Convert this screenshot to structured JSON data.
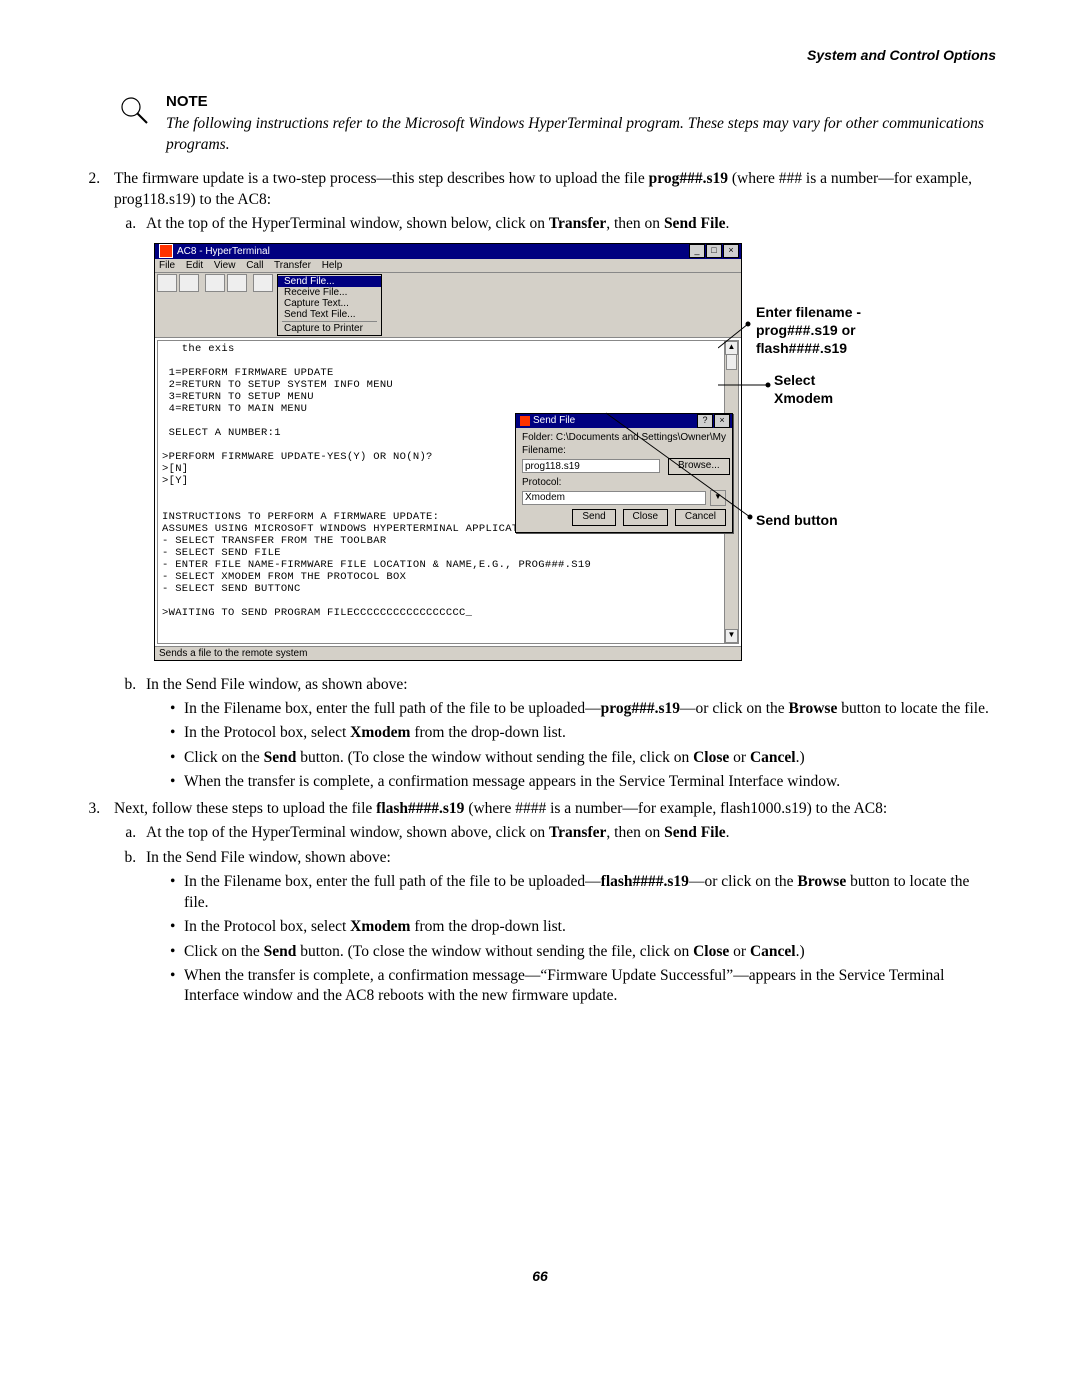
{
  "header": {
    "section": "System and Control Options"
  },
  "note": {
    "title": "NOTE",
    "body": "The following instructions refer to the Microsoft Windows HyperTerminal program. These steps may vary for other communications programs."
  },
  "step2": {
    "intro_a": "The firmware update is a two-step process—this step describes how to upload the file ",
    "intro_b": "prog###.s19",
    "intro_c": " (where ### is a number—for example, prog118.s19) to the AC8:",
    "a_pre": "At the top of the HyperTerminal window, shown below, click on ",
    "a_b1": "Transfer",
    "a_mid": ", then on ",
    "a_b2": "Send File",
    "a_end": ".",
    "b_intro": "In the Send File window, as shown above:",
    "b1_a": "In the Filename box, enter the full path of the file to be uploaded—",
    "b1_b": "prog###.s19",
    "b1_c": "—or click on the ",
    "b1_d": "Browse",
    "b1_e": " button to locate the file.",
    "b2_a": "In the Protocol box, select ",
    "b2_b": "Xmodem",
    "b2_c": " from the drop-down list.",
    "b3_a": "Click on the ",
    "b3_b": "Send",
    "b3_c": " button. (To close the window without sending the file, click on ",
    "b3_d": "Close",
    "b3_e": " or ",
    "b3_f": "Cancel",
    "b3_g": ".)",
    "b4": "When the transfer is complete, a confirmation message appears in the Service Terminal Interface window."
  },
  "step3": {
    "intro_a": "Next, follow these steps to upload the file ",
    "intro_b": "flash####.s19",
    "intro_c": " (where #### is a number—for example, flash1000.s19) to the AC8:",
    "a_pre": "At the top of the HyperTerminal window, shown above, click on ",
    "a_b1": "Transfer",
    "a_mid": ", then on ",
    "a_b2": "Send File",
    "a_end": ".",
    "b_intro": "In the Send File window, shown above:",
    "b1_a": "In the Filename box, enter the full path of the file to be uploaded—",
    "b1_b": "flash####.s19",
    "b1_c": "—or click on the ",
    "b1_d": "Browse",
    "b1_e": " button to locate the file.",
    "b2_a": "In the Protocol box, select ",
    "b2_b": "Xmodem",
    "b2_c": " from the drop-down list.",
    "b3_a": "Click on the ",
    "b3_b": "Send",
    "b3_c": " button. (To close the window without sending the file, click on ",
    "b3_d": "Close",
    "b3_e": " or ",
    "b3_f": "Cancel",
    "b3_g": ".)",
    "b4": "When the transfer is complete, a confirmation message—“Firmware Update Successful”—appears in the Service Terminal Interface window and the AC8 reboots with the new firmware update."
  },
  "hyper": {
    "title": "AC8 - HyperTerminal",
    "menus": [
      "File",
      "Edit",
      "View",
      "Call",
      "Transfer",
      "Help"
    ],
    "dropdown": [
      "Send File...",
      "Receive File...",
      "Capture Text...",
      "Send Text File...",
      "Capture to Printer"
    ],
    "term_lines": [
      "   the exis",
      "",
      " 1=PERFORM FIRMWARE UPDATE",
      " 2=RETURN TO SETUP SYSTEM INFO MENU",
      " 3=RETURN TO SETUP MENU",
      " 4=RETURN TO MAIN MENU",
      "",
      " SELECT A NUMBER:1",
      "",
      ">PERFORM FIRMWARE UPDATE-YES(Y) OR NO(N)?",
      ">[N]",
      ">[Y]",
      "",
      "",
      "INSTRUCTIONS TO PERFORM A FIRMWARE UPDATE:",
      "ASSUMES USING MICROSOFT WINDOWS HYPERTERMINAL APPLICATION",
      "- SELECT TRANSFER FROM THE TOOLBAR",
      "- SELECT SEND FILE",
      "- ENTER FILE NAME-FIRMWARE FILE LOCATION & NAME,E.G., PROG###.S19",
      "- SELECT XMODEM FROM THE PROTOCOL BOX",
      "- SELECT SEND BUTTONC",
      "",
      ">WAITING TO SEND PROGRAM FILECCCCCCCCCCCCCCCCC_"
    ],
    "status": "Sends a file to the remote system",
    "send": {
      "title": "Send File",
      "folder_label": "Folder: C:\\Documents and Settings\\Owner\\My",
      "filename_label": "Filename:",
      "filename_value": "prog118.s19",
      "browse": "Browse...",
      "protocol_label": "Protocol:",
      "protocol_value": "Xmodem",
      "btn_send": "Send",
      "btn_close": "Close",
      "btn_cancel": "Cancel"
    }
  },
  "annot": {
    "a1a": "Enter filename -",
    "a1b": "prog###.s19 or",
    "a1c": "flash####.s19",
    "a2a": "Select",
    "a2b": "Xmodem",
    "a3": "Send button"
  },
  "page_number": "66"
}
